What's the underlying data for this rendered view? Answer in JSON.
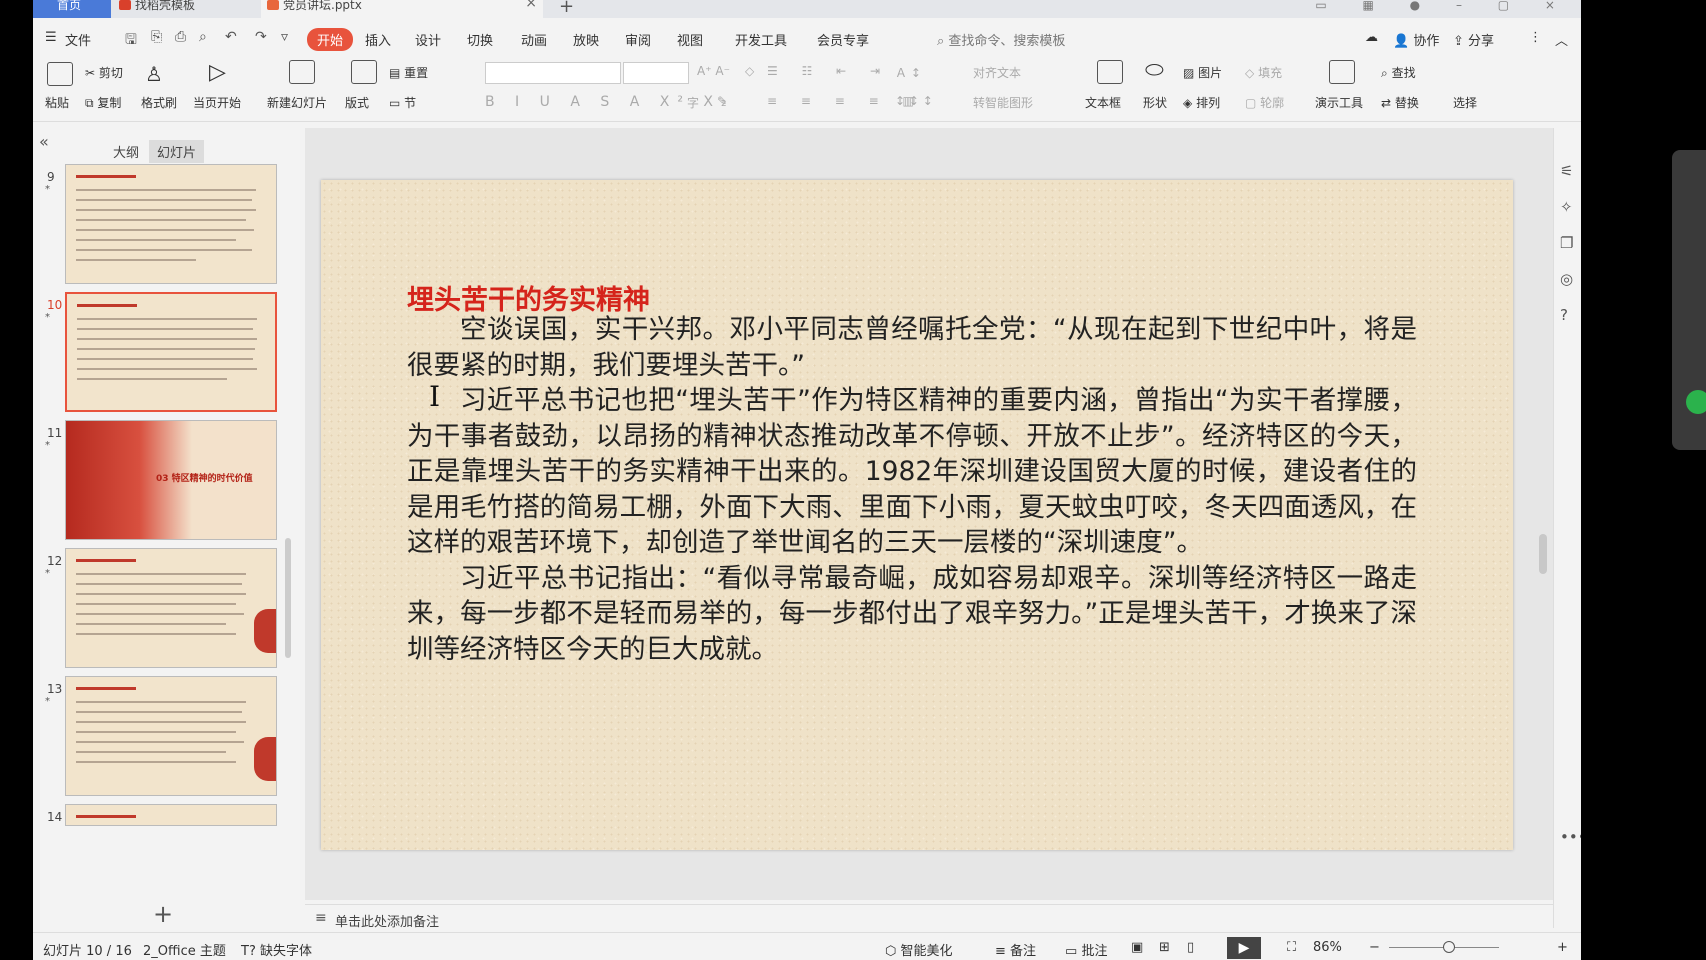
{
  "tabs": {
    "home": "首页",
    "tab1": "找稻壳模板",
    "tab2": "党员讲坛.pptx"
  },
  "menu": {
    "file": "文件",
    "items": [
      "开始",
      "插入",
      "设计",
      "切换",
      "动画",
      "放映",
      "审阅",
      "视图",
      "开发工具",
      "会员专享"
    ],
    "search": "查找命令、搜索模板",
    "collab": "协作",
    "share": "分享"
  },
  "ribbon": {
    "paste": "粘贴",
    "cut": "剪切",
    "copy": "复制",
    "format_painter": "格式刷",
    "from_current": "当页开始",
    "new_slide": "新建幻灯片",
    "layout": "版式",
    "reset": "重置",
    "section": "节",
    "align_text": "对齐文本",
    "smart_art": "转智能图形",
    "textbox": "文本框",
    "shape": "形状",
    "picture": "图片",
    "arrange": "排列",
    "fill": "填充",
    "outline": "轮廓",
    "present_tools": "演示工具",
    "find": "查找",
    "replace": "替换",
    "select": "选择"
  },
  "left_panel": {
    "tab_outline": "大纲",
    "tab_slides": "幻灯片",
    "thumbnails": [
      {
        "num": "9",
        "text": ""
      },
      {
        "num": "10",
        "text": ""
      },
      {
        "num": "11",
        "text": "03 特区精神的时代价值"
      },
      {
        "num": "12",
        "text": ""
      },
      {
        "num": "13",
        "text": ""
      },
      {
        "num": "14",
        "text": ""
      }
    ],
    "star": "*"
  },
  "slide": {
    "title": "埋头苦干的务实精神",
    "paragraphs": [
      "空谈误国，实干兴邦。邓小平同志曾经嘱托全党：“从现在起到下世纪中叶，将是很要紧的时期，我们要埋头苦干。”",
      "习近平总书记也把“埋头苦干”作为特区精神的重要内涵，曾指出“为实干者撑腰，为干事者鼓劲，以昂扬的精神状态推动改革不停顿、开放不止步”。经济特区的今天，正是靠埋头苦干的务实精神干出来的。1982年深圳建设国贸大厦的时候，建设者住的是用毛竹搭的简易工棚，外面下大雨、里面下小雨，夏天蚊虫叮咬，冬天四面透风，在这样的艰苦环境下，却创造了举世闻名的三天一层楼的“深圳速度”。",
      "习近平总书记指出：“看似寻常最奇崛，成如容易却艰辛。深圳等经济特区一路走来，每一步都不是轻而易举的，每一步都付出了艰辛努力。”正是埋头苦干，才换来了深圳等经济特区今天的巨大成就。"
    ]
  },
  "notes": {
    "placeholder": "单击此处添加备注"
  },
  "status": {
    "slide_counter": "幻灯片 10 / 16",
    "theme": "2_Office 主题",
    "missing_font": "缺失字体",
    "smart_beautify": "智能美化",
    "notes": "备注",
    "comments": "批注",
    "zoom": "86%"
  }
}
